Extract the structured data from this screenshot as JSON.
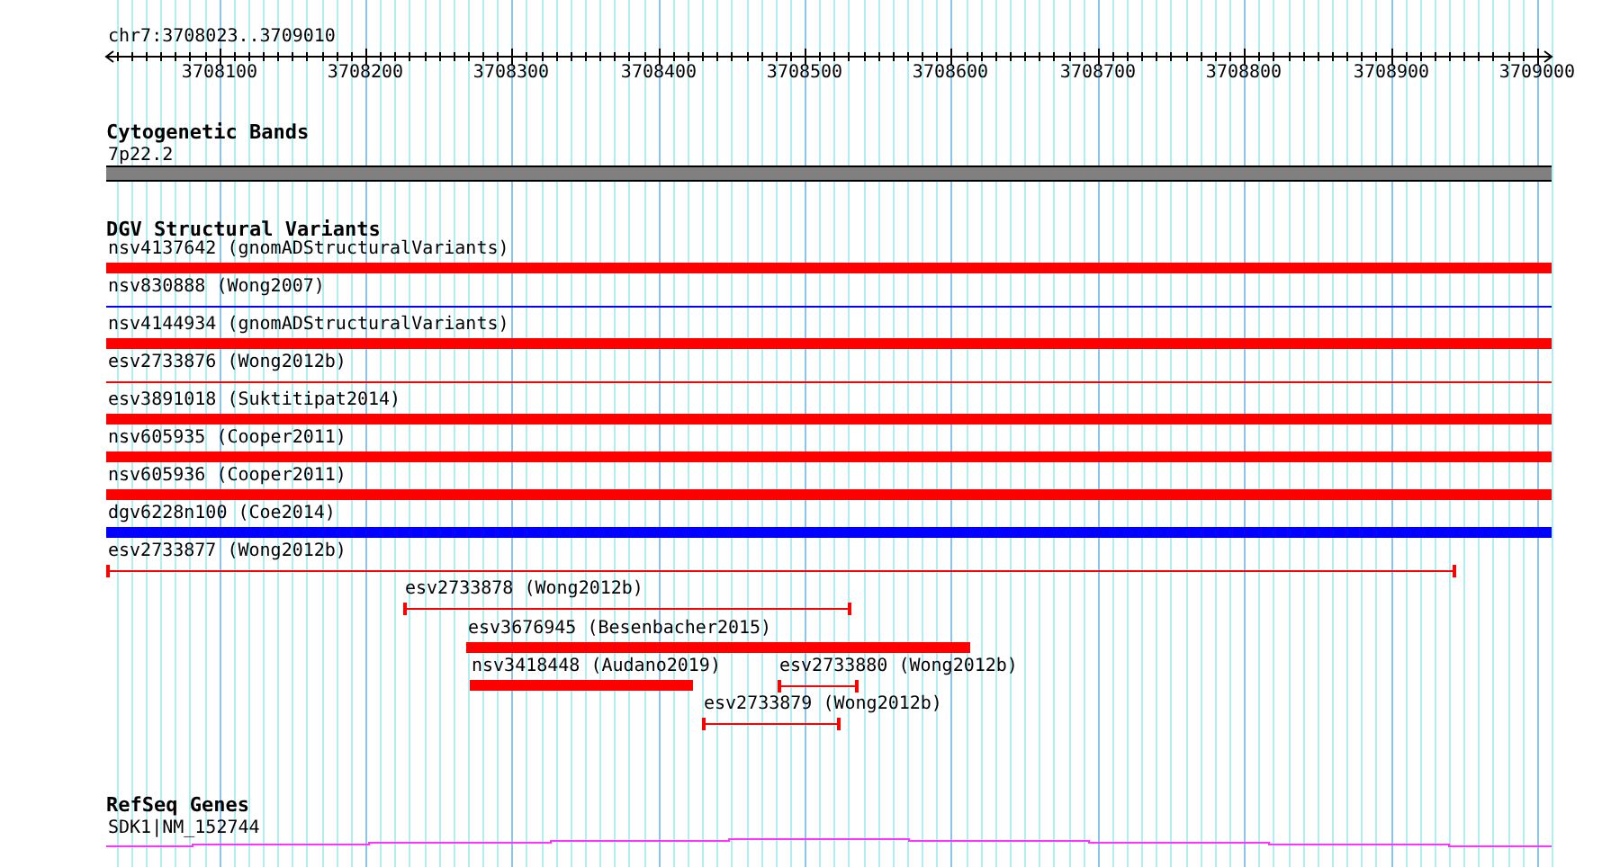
{
  "location": "chr7:3708023..3709010",
  "ruler": {
    "ticks": [
      "3708100",
      "3708200",
      "3708300",
      "3708400",
      "3708500",
      "3708600",
      "3708700",
      "3708800",
      "3708900",
      "3709000"
    ]
  },
  "tracks": [
    {
      "kind": "bands",
      "title": "Cytogenetic Bands",
      "features": [
        {
          "label": "7p22.2",
          "kind": "band"
        }
      ]
    },
    {
      "kind": "variants",
      "title": "DGV Structural Variants",
      "features": [
        {
          "label": "nsv4137642 (gnomADStructuralVariants)",
          "kind": "bar",
          "color": "#ff0000"
        },
        {
          "label": "nsv830888 (Wong2007)",
          "kind": "line",
          "color": "#0000ff"
        },
        {
          "label": "nsv4144934 (gnomADStructuralVariants)",
          "kind": "bar",
          "color": "#ff0000"
        },
        {
          "label": "esv2733876 (Wong2012b)",
          "kind": "line",
          "color": "#ff0000"
        },
        {
          "label": "esv3891018 (Suktitipat2014)",
          "kind": "bar",
          "color": "#ff0000"
        },
        {
          "label": "nsv605935 (Cooper2011)",
          "kind": "bar",
          "color": "#ff0000"
        },
        {
          "label": "nsv605936 (Cooper2011)",
          "kind": "bar",
          "color": "#ff0000"
        },
        {
          "label": "dgv6228n100 (Coe2014)",
          "kind": "bar",
          "color": "#0000ff"
        },
        {
          "label": "esv2733877 (Wong2012b)",
          "kind": "capped",
          "color": "#ff0000"
        },
        {
          "label": "esv2733878 (Wong2012b)",
          "kind": "capped",
          "color": "#ff0000"
        },
        {
          "label": "esv3676945 (Besenbacher2015)",
          "kind": "bar",
          "color": "#ff0000"
        },
        {
          "label": "nsv3418448 (Audano2019)",
          "kind": "bar",
          "color": "#ff0000"
        },
        {
          "label": "esv2733880 (Wong2012b)",
          "kind": "capped",
          "color": "#ff0000"
        },
        {
          "label": "esv2733879 (Wong2012b)",
          "kind": "capped",
          "color": "#ff0000"
        }
      ]
    },
    {
      "kind": "genes",
      "title": "RefSeq Genes",
      "features": [
        {
          "label": "SDK1|NM_152744",
          "kind": "gene"
        }
      ]
    }
  ]
}
